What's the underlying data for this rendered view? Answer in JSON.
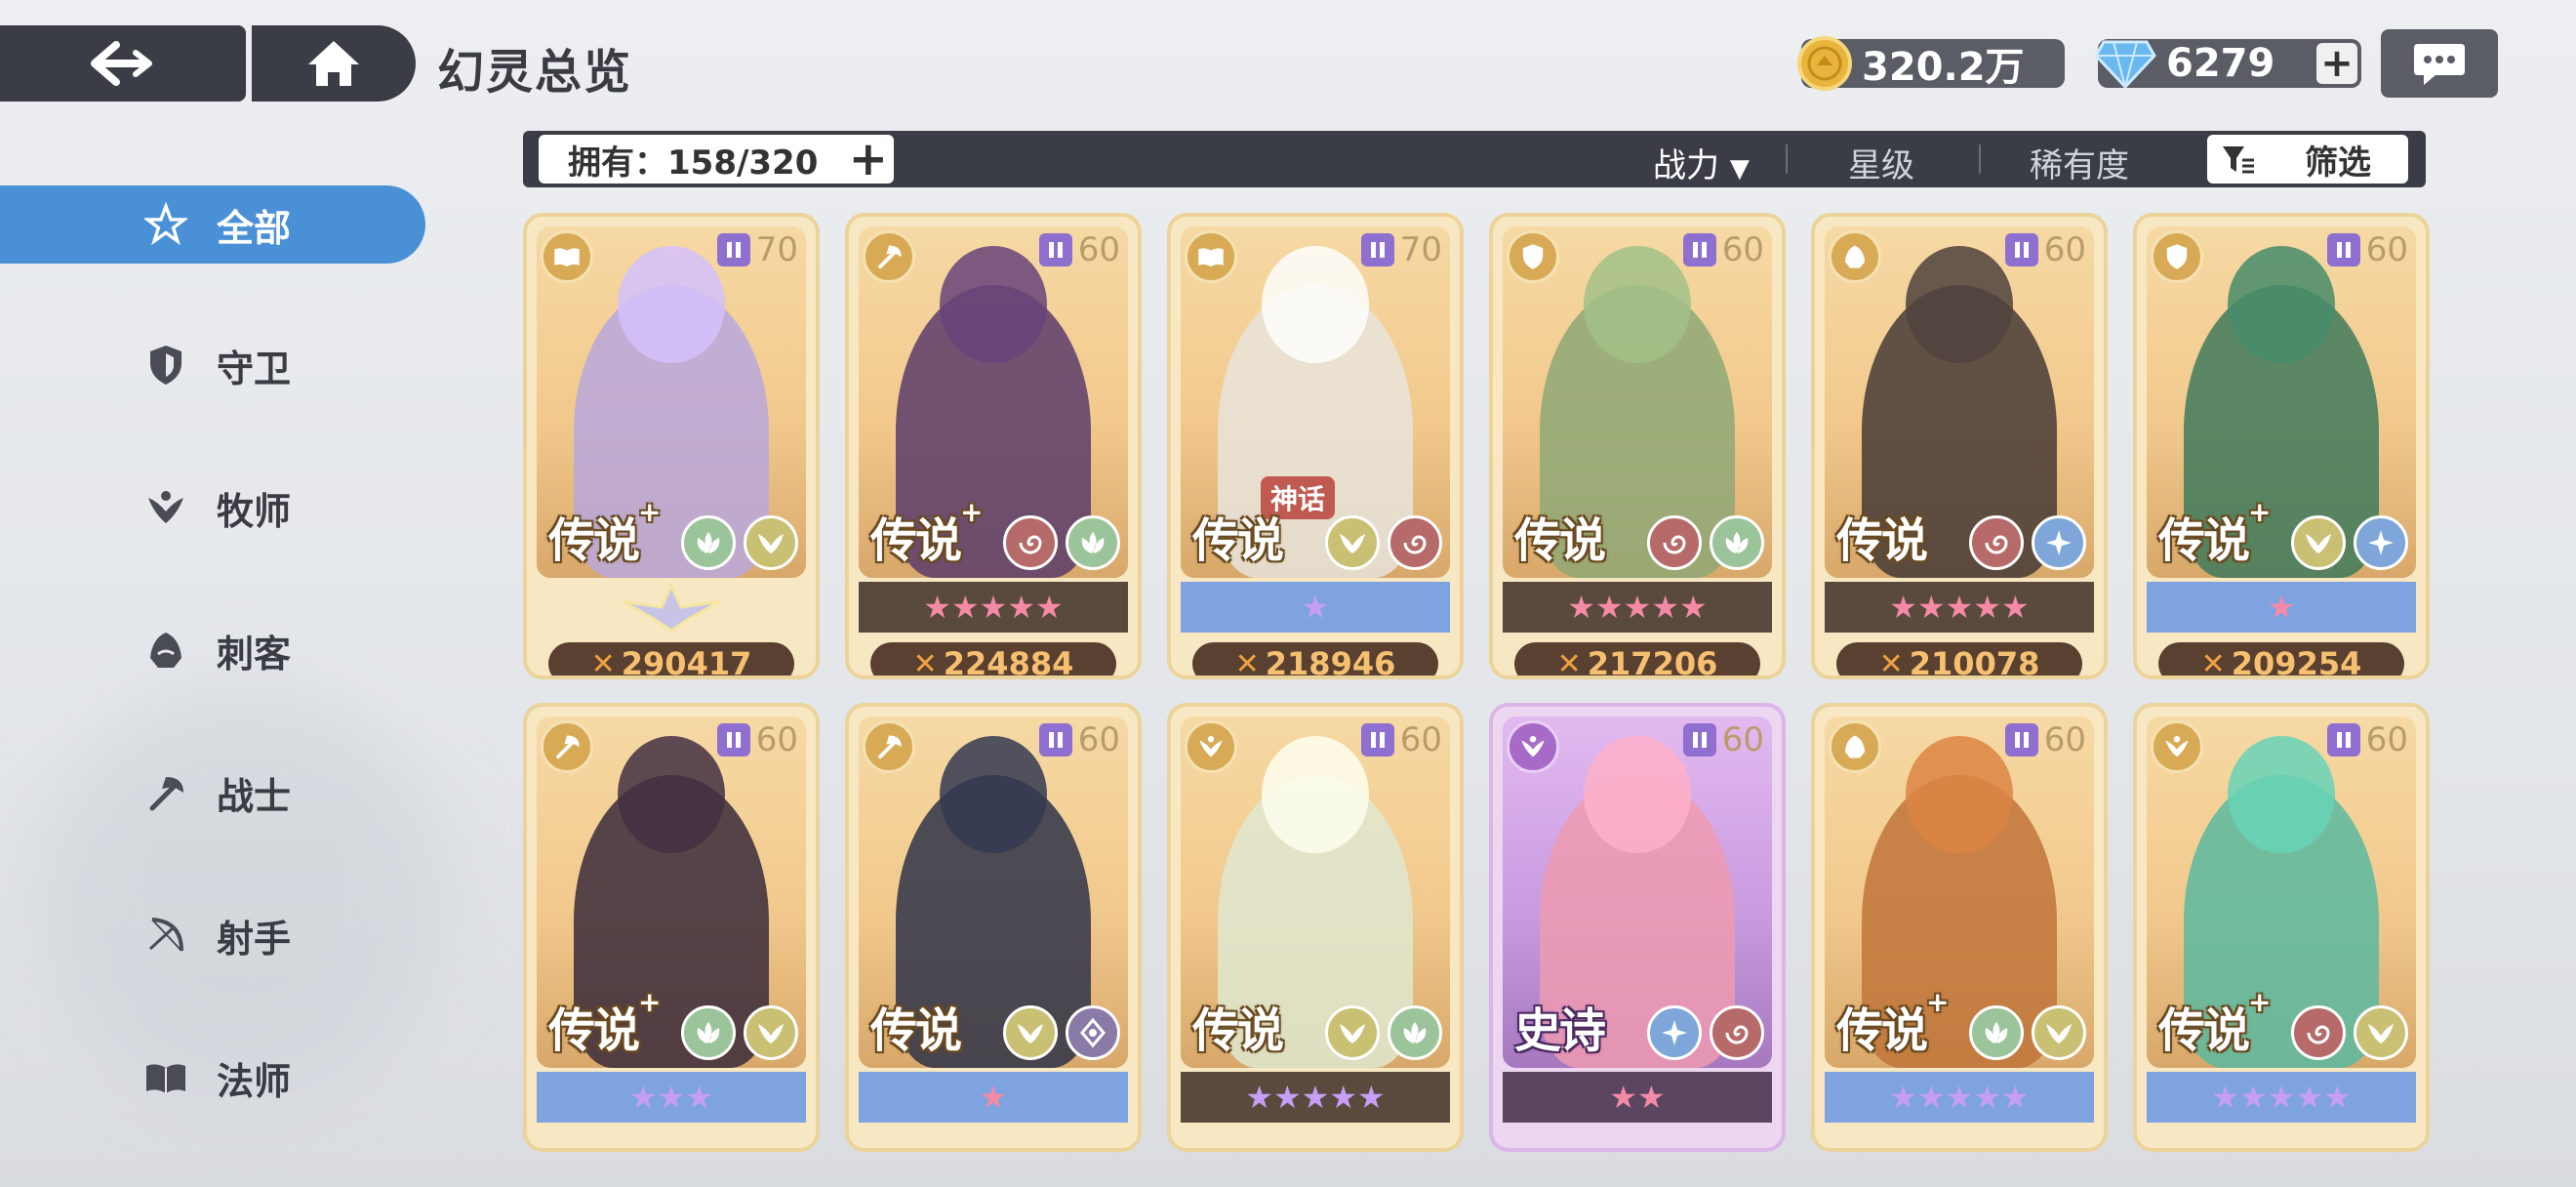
{
  "header": {
    "title": "幻灵总览"
  },
  "currency": {
    "gold": "320.2万",
    "diamond": "6279"
  },
  "sidebar": {
    "items": [
      {
        "label": "全部",
        "icon": "star-icon",
        "active": true
      },
      {
        "label": "守卫",
        "icon": "shield-icon"
      },
      {
        "label": "牧师",
        "icon": "wings-icon"
      },
      {
        "label": "刺客",
        "icon": "assassin-icon"
      },
      {
        "label": "战士",
        "icon": "axe-icon"
      },
      {
        "label": "射手",
        "icon": "bow-icon"
      },
      {
        "label": "法师",
        "icon": "book-icon"
      }
    ]
  },
  "filter": {
    "owned": "拥有：158/320",
    "sort_power": "战力",
    "sort_star": "星级",
    "sort_rarity": "稀有度",
    "filter_label": "筛选"
  },
  "cards": [
    {
      "role": "book",
      "level": "70",
      "rarity": "传说",
      "plus": true,
      "elements": [
        "nature",
        "light"
      ],
      "stars": "★",
      "strip": "none",
      "power": "290417",
      "palette": "#b9a8dd"
    },
    {
      "role": "axe",
      "level": "60",
      "rarity": "传说",
      "plus": true,
      "elements": [
        "chaos",
        "nature"
      ],
      "stars": "★★★★★",
      "strip": "dark",
      "power": "224884",
      "palette": "#5b3b6b"
    },
    {
      "role": "book",
      "level": "70",
      "rarity": "传说",
      "plus": false,
      "myth": "神话",
      "elements": [
        "light",
        "chaos"
      ],
      "stars": "★",
      "strip": "blue",
      "star_color": "purple",
      "power": "218946",
      "palette": "#e8e4dc"
    },
    {
      "role": "shield",
      "level": "60",
      "rarity": "传说",
      "plus": false,
      "elements": [
        "chaos",
        "nature"
      ],
      "stars": "★★★★★",
      "strip": "dark",
      "power": "217206",
      "palette": "#8ea876"
    },
    {
      "role": "assassin",
      "level": "60",
      "rarity": "传说",
      "plus": false,
      "elements": [
        "chaos",
        "frost"
      ],
      "stars": "★★★★★",
      "strip": "dark",
      "power": "210078",
      "palette": "#463a36"
    },
    {
      "role": "shield",
      "level": "60",
      "rarity": "传说",
      "plus": true,
      "elements": [
        "light",
        "frost"
      ],
      "stars": "★",
      "strip": "blue",
      "power": "209254",
      "palette": "#3f7a5c"
    },
    {
      "role": "axe",
      "level": "60",
      "rarity": "传说",
      "plus": true,
      "elements": [
        "nature",
        "light"
      ],
      "stars": "★★★",
      "strip": "blue",
      "star_color": "purple",
      "power": "",
      "palette": "#3a2a3a"
    },
    {
      "role": "axe",
      "level": "60",
      "rarity": "传说",
      "plus": false,
      "elements": [
        "light",
        "arcane"
      ],
      "stars": "★",
      "strip": "blue",
      "power": "",
      "palette": "#2e3248"
    },
    {
      "role": "wings",
      "level": "60",
      "rarity": "传说",
      "plus": false,
      "elements": [
        "light",
        "nature"
      ],
      "stars": "★★★★★",
      "strip": "dark",
      "star_color": "purple",
      "power": "",
      "palette": "#dfe8d0"
    },
    {
      "role": "wings",
      "level": "60",
      "rarity": "史诗",
      "plus": false,
      "epic": true,
      "elements": [
        "frost",
        "chaos"
      ],
      "stars": "★★",
      "strip": "dark",
      "power": "",
      "palette": "#ef9ab0"
    },
    {
      "role": "assassin",
      "level": "60",
      "rarity": "传说",
      "plus": true,
      "elements": [
        "nature",
        "light"
      ],
      "stars": "★★★★★",
      "strip": "blue",
      "star_color": "purple",
      "power": "",
      "palette": "#c0743a"
    },
    {
      "role": "wings",
      "level": "60",
      "rarity": "传说",
      "plus": true,
      "elements": [
        "chaos",
        "light"
      ],
      "stars": "★★★★★",
      "strip": "blue",
      "star_color": "purple",
      "power": "",
      "palette": "#5ab8a0"
    }
  ]
}
